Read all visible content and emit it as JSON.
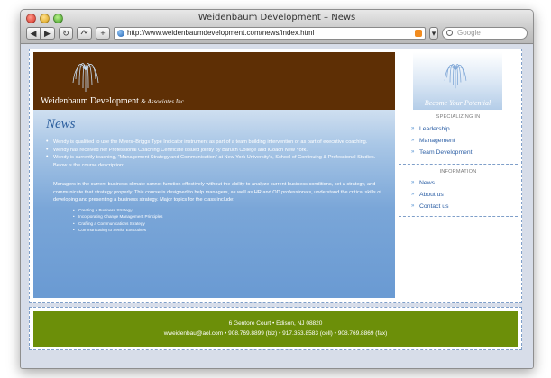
{
  "browser": {
    "window_title": "Weidenbaum Development – News",
    "url": "http://www.weidenbaumdevelopment.com/news/index.html",
    "search_placeholder": "Google",
    "back_label": "◀",
    "forward_label": "▶",
    "reload_label": "↻",
    "add_label": "+",
    "chevron_label": "▾"
  },
  "header": {
    "brand": "Weidenbaum Development",
    "brand_suffix": "& Associates Inc."
  },
  "main": {
    "title": "News",
    "bullets": [
      "Wendy is qualified to use the Myers–Briggs Type Indicator instrument as part of a team building intervention or as part of executive coaching.",
      "Wendy has received her Professional Coaching Certificate issued jointly by Baruch College and iCoach New York.",
      "Wendy is currently teaching, “Management Strategy and Communication” at New York University's, School of Continuing & Professional Studies. Below is the course description:"
    ],
    "course_description": "Managers in the current business climate cannot function effectively without the ability to analyze current business conditions, set a strategy, and communicate that strategy properly. This course is designed to help managers, as well as HR and OD professionals, understand the critical skills of developing and presenting a business strategy. Major topics for the class include:",
    "topics": [
      "Creating a Business Strategy",
      "Incorporating Change Management Principles",
      "Crafting a Communications Strategy",
      "Communicating to Senior Executives"
    ]
  },
  "sidebar": {
    "tagline": "Become Your Potential",
    "specializing_title": "SPECIALIZING IN",
    "specializing_items": [
      "Leadership",
      "Management",
      "Team Development"
    ],
    "information_title": "INFORMATION",
    "information_items": [
      "News",
      "About us",
      "Contact us"
    ]
  },
  "footer": {
    "address": "6 Gentore Court • Edison, NJ 08820",
    "contact": "wweidenbau@aol.com • 908.769.8899 (biz) • 917.353.8583 (cell) • 908.769.8869 (fax)"
  },
  "colors": {
    "header_brown": "#5e2f05",
    "content_blue": "#6b9bd3",
    "link_blue": "#2c5fa5",
    "footer_green": "#6c8f09"
  }
}
